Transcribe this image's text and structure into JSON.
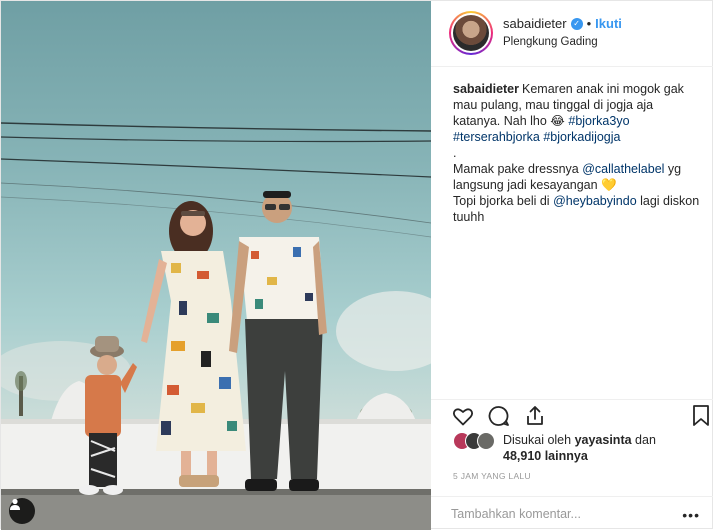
{
  "post": {
    "username": "sabaidieter",
    "follow_label": "Ikuti",
    "separator": "•",
    "location": "Plengkung Gading",
    "caption": {
      "author": "sabaidieter",
      "text_1": "Kemaren anak ini mogok gak mau pulang, mau tinggal di jogja aja katanya. Nah lho 😂 ",
      "tag_1": "#bjorka3yo",
      "tag_2": "#terserahbjorka",
      "tag_3": "#bjorkadijogja",
      "dot_line": ".",
      "text_2": "Mamak pake dressnya ",
      "mention_1": "@callathelabel",
      "text_3": " yg langsung jadi kesayangan 💛",
      "text_4": "Topi bjorka beli di ",
      "mention_2": "@heybabyindo",
      "text_5": " lagi diskon tuuhh"
    },
    "likes": {
      "prefix": "Disukai oleh ",
      "user": "yayasinta",
      "middle": " dan ",
      "count": "48,910 lainnya"
    },
    "timestamp": "5 JAM YANG LALU",
    "comment_placeholder": "Tambahkan komentar...",
    "more_label": "•••"
  },
  "icons": {
    "verified": "verified-badge-icon",
    "like": "heart-icon",
    "comment": "comment-bubble-icon",
    "share": "share-icon",
    "save": "bookmark-icon",
    "tag": "user-tag-icon"
  },
  "colors": {
    "link": "#003569",
    "follow": "#3897f0",
    "muted": "#999999",
    "border": "#efefef"
  }
}
